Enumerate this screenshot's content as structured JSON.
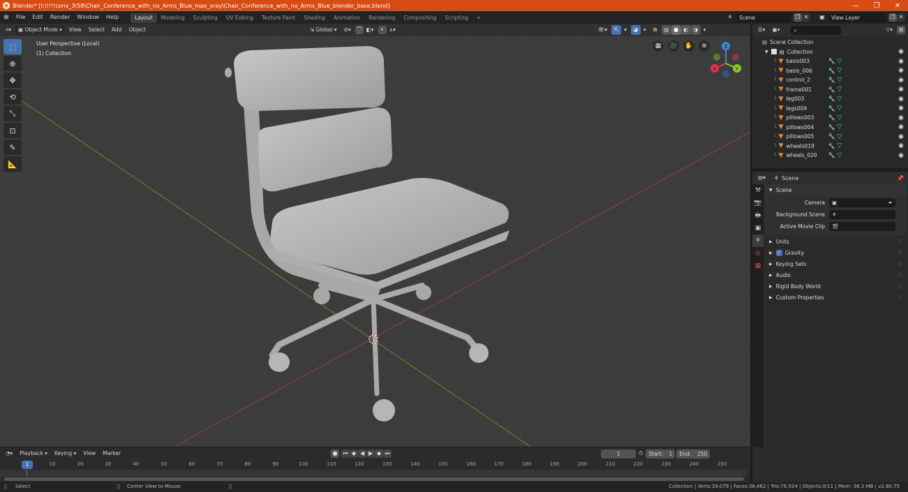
{
  "window": {
    "title": "Blender* [I:\\!!!!conv_3\\58\\Chair_Conference_with_no_Arms_Blue_max_vray\\Chair_Conference_with_no_Arms_Blue_blender_base.blend]",
    "minimize": "—",
    "maximize": "❐",
    "close": "✕"
  },
  "menubar": {
    "items": [
      "File",
      "Edit",
      "Render",
      "Window",
      "Help"
    ],
    "workspaces": [
      "Layout",
      "Modeling",
      "Sculpting",
      "UV Editing",
      "Texture Paint",
      "Shading",
      "Animation",
      "Rendering",
      "Compositing",
      "Scripting"
    ],
    "active_workspace": "Layout",
    "add_tab": "+",
    "scene_label": "Scene",
    "view_layer_label": "View Layer"
  },
  "viewport": {
    "header": {
      "mode": "Object Mode",
      "menus": [
        "View",
        "Select",
        "Add",
        "Object"
      ],
      "transform_orientation": "Global"
    },
    "overlay_text": {
      "perspective": "User Perspective (Local)",
      "collection": "(1) Collection"
    },
    "gizmo": {
      "x_label": "X",
      "y_label": "Y",
      "z_label": "Z",
      "x_color": "#e5334f",
      "y_color": "#8bc72b",
      "z_color": "#3b86d9"
    },
    "axis_colors": {
      "x_line": "#9a3c44",
      "y_line": "#6f8a28"
    },
    "mesh_color": "#bdbdbd"
  },
  "outliner": {
    "search_placeholder": "",
    "root": "Scene Collection",
    "collection": "Collection",
    "objects": [
      "basis003",
      "basis_006",
      "control_2",
      "frame001",
      "leg003",
      "legs009",
      "pillows003",
      "pillows004",
      "pillows005",
      "wheels019",
      "wheels_020"
    ]
  },
  "properties": {
    "header_title": "Scene",
    "panel_title": "Scene",
    "fields": [
      {
        "label": "Camera",
        "value": ""
      },
      {
        "label": "Background Scene",
        "value": ""
      },
      {
        "label": "Active Movie Clip",
        "value": ""
      }
    ],
    "sections": [
      {
        "label": "Units",
        "checkbox": false
      },
      {
        "label": "Gravity",
        "checkbox": true
      },
      {
        "label": "Keying Sets",
        "checkbox": false
      },
      {
        "label": "Audio",
        "checkbox": false
      },
      {
        "label": "Rigid Body World",
        "checkbox": false
      },
      {
        "label": "Custom Properties",
        "checkbox": false
      }
    ]
  },
  "timeline": {
    "menus": [
      "Playback",
      "Keying",
      "View",
      "Marker"
    ],
    "current_frame": "1",
    "start_label": "Start:",
    "start": "1",
    "end_label": "End:",
    "end": "250",
    "ticks": [
      "1",
      "10",
      "20",
      "30",
      "40",
      "50",
      "60",
      "70",
      "80",
      "90",
      "100",
      "110",
      "120",
      "130",
      "140",
      "150",
      "160",
      "170",
      "180",
      "190",
      "200",
      "210",
      "220",
      "230",
      "240",
      "250"
    ]
  },
  "statusbar": {
    "select": "Select",
    "center_view": "Center View to Mouse",
    "stats": "Collection | Verts:39,079 | Faces:38,462 | Tris:76,924 | Objects:0/11 | Mem: 36.3 MB | v2.80.75"
  }
}
